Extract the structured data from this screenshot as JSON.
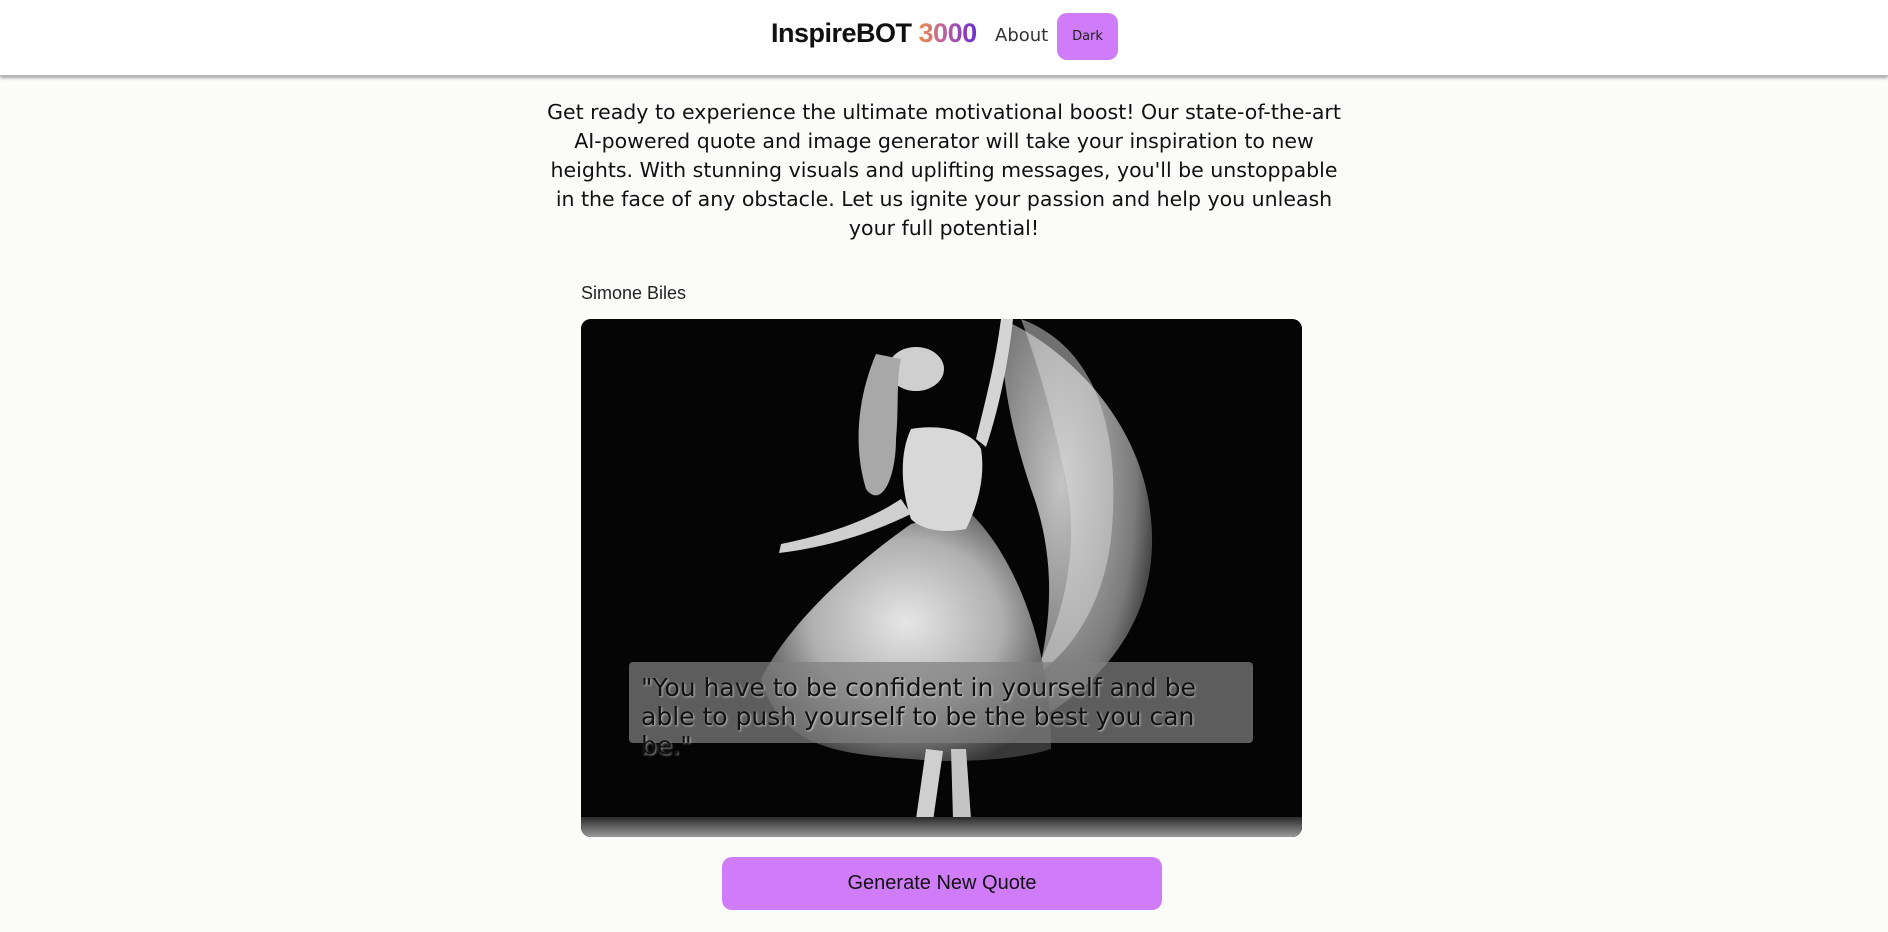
{
  "header": {
    "logo_text": "InspireBOT ",
    "logo_number": "3000",
    "nav_about": "About",
    "theme_button": "Dark"
  },
  "intro": {
    "text": "Get ready to experience the ultimate motivational boost! Our state-of-the-art AI-powered quote and image generator will take your inspiration to new heights. With stunning visuals and uplifting messages, you'll be unstoppable in the face of any obstacle. Let us ignite your passion and help you unleash your full potential!"
  },
  "quote": {
    "author": "Simone Biles",
    "text": "\"You have to be confident in yourself and be able to push yourself to be the best you can be.\"",
    "image_subject": "dancer-photo"
  },
  "actions": {
    "generate_label": "Generate New Quote"
  },
  "colors": {
    "accent": "#d07cf8",
    "background": "#fbfbfa",
    "header_bg": "#ffffff"
  }
}
